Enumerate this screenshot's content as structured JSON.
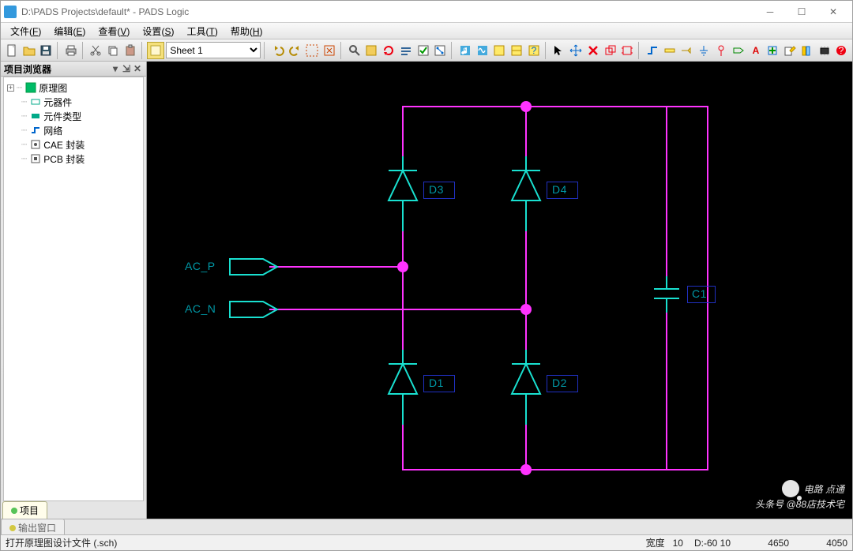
{
  "title": "D:\\PADS Projects\\default* - PADS Logic",
  "menus": {
    "file": "文件",
    "edit": "编辑",
    "view": "查看",
    "set": "设置",
    "tool": "工具",
    "help": "帮助",
    "file_k": "F",
    "edit_k": "E",
    "view_k": "V",
    "set_k": "S",
    "tool_k": "T",
    "help_k": "H"
  },
  "sheet_selector": {
    "value": "Sheet 1"
  },
  "tree": {
    "header": "项目浏览器",
    "root": "原理图",
    "items": [
      "元器件",
      "元件类型",
      "网络",
      "CAE 封装",
      "PCB 封装"
    ]
  },
  "sidebar_tab": "项目",
  "output_tab": "输出窗口",
  "status": {
    "msg": "打开原理图设计文件 (.sch)",
    "w_label": "宽度",
    "w_val": "10",
    "d_label": "D:",
    "d_val": "-60 10",
    "x": "4650",
    "y": "4050"
  },
  "schematic": {
    "labels": {
      "d1": "D1",
      "d2": "D2",
      "d3": "D3",
      "d4": "D4",
      "c1": "C1",
      "acp": "AC_P",
      "acn": "AC_N"
    }
  },
  "watermark": {
    "l1": "电路     点通",
    "l2": "头条号 @88店技术宅"
  },
  "colors": {
    "wire_pink": "#ff33ff",
    "wire_teal": "#19e0d0",
    "node": "#ff33ff",
    "label": "#0098a6",
    "box": "#2030c0"
  }
}
